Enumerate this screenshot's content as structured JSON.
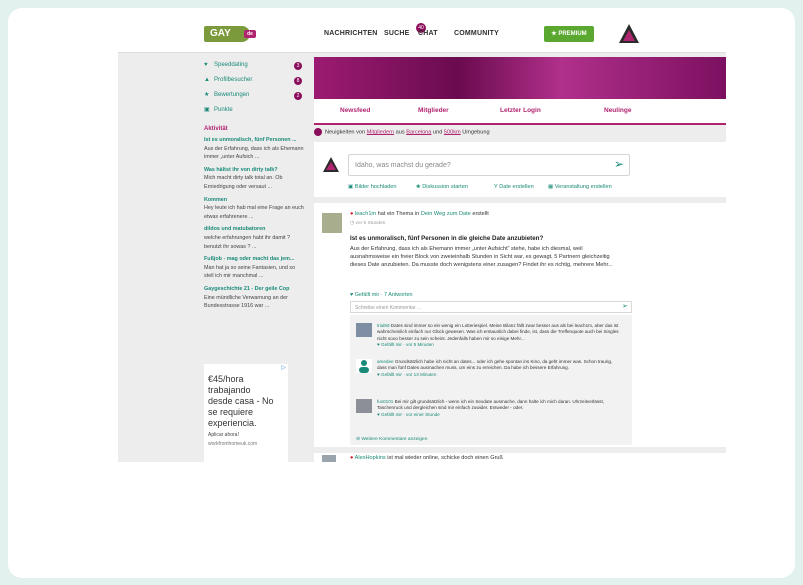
{
  "nav": {
    "logo": "GAY",
    "logo_tag": "de",
    "items": [
      "NACHRICHTEN",
      "SUCHE",
      "CHAT",
      "COMMUNITY"
    ],
    "chat_badge": "40",
    "premium": "PREMIUM"
  },
  "sidebar": {
    "items": [
      {
        "label": "Speeddating",
        "badge": "3"
      },
      {
        "label": "Profilbesucher",
        "badge": "8"
      },
      {
        "label": "Bewertungen",
        "badge": "2"
      },
      {
        "label": "Punkte",
        "badge": ""
      }
    ],
    "aktivitaet_title": "Aktivität",
    "aktivitaet": [
      {
        "title": "Ist es unmoralisch, fünf Personen ...",
        "desc": "Aus der Erfahrung, dass ich als Ehemann immer „unter Aufsich ..."
      },
      {
        "title": "Was hältst ihr von dirty talk?",
        "desc": "Mich macht dirty talk total an. Ob Erniedrigung oder versaut ..."
      },
      {
        "title": "Kommen",
        "desc": "Hey leute ich hab mal eine Frage an euch etwas erfahrenere ..."
      },
      {
        "title": "dildos und matubatoren",
        "desc": "welche erfahrungen habt ihr damit ? benutzt ihr sowas ? ..."
      },
      {
        "title": "Fußjob - mag oder macht das jem...",
        "desc": "Man hat ja so seine Fantasien, und so stell ich mir manchmal ..."
      },
      {
        "title": "Gaygeschichte 21 - Der geile Cop",
        "desc": "Eine mündliche Verwarnung an der Bundesstrasse 1916 war ..."
      }
    ]
  },
  "ad": {
    "line1": "€45/hora",
    "line2": "trabajando",
    "line3": "desde casa - No",
    "line4": "se requiere",
    "line5": "experiencia.",
    "cta": "Aplicar ahora!",
    "url": "workfromhomeuk.com"
  },
  "tabs": [
    "Newsfeed",
    "Mitglieder",
    "Letzter Login",
    "Neulinge"
  ],
  "info": {
    "pre": "Neuigkeiten von",
    "link1": "Mitgliedern",
    "mid": "aus",
    "link2": "Barcelona",
    "mid2": "und",
    "link3": "500km",
    "post": "Umgebung"
  },
  "composer": {
    "placeholder": "Idaho, was machst du gerade?",
    "actions": [
      "Bilder hochladen",
      "Diskussion starten",
      "Date erstellen",
      "Veranstaltung erstellen"
    ]
  },
  "post": {
    "user": "leach1m",
    "text": "hat ein Thema in",
    "topic": "Dein Weg zum Date",
    "suffix": "erstellt",
    "time": "vor 5 Stunden",
    "title": "Ist es unmoralisch, fünf Personen in die gleiche Date anzubieten?",
    "body": "Aus der Erfahrung, dass ich als Ehemann immer „unter Aufsicht“ stehe, habe ich diesmal, weil ausnahmsweise ein freier Block von zweieinhalb Stunden in Sicht war, es gewagt, 5 Partnern gleichzeitig dieses Date anzubieten. Da musste doch wenigstens einer zusagen? Findet ihr es richtig, mehrere Mehr...",
    "likes": "Gefällt mir · 7 Antworten",
    "comment_placeholder": "Schreibe einen Kommentar ..."
  },
  "comments": [
    {
      "user": "trial59",
      "text": "Dates sind immer so ein wenig ein Lotteriespiel. Meine Bilanz fällt zwar besser aus als bei leach1m, aber das ist wahrscheinlich einfach nur Glück gewesen. Was ich erstaunlich dabei finde, ist, dass die Treffenquote auch bei Singles nicht sooo besser zu sein scheint. Jedenfalls haben mir so einige Mehr...",
      "meta": "Gefällt mir · vor 5 Minuten"
    },
    {
      "user": "amedee",
      "text": "Grundsätzlich habe ich nicht an dates... oder ich gehe spontan ins Kino, da geht immer was. Schon traurig, dass man fünf Dates ausmachen muss, um eins zu erreichen. Da habe ich bessere Erfahrung.",
      "meta": "Gefällt mir · vor 13 Minuten"
    },
    {
      "user": "fux0101",
      "text": "Bei mir gilt grundsätzlich - wenn ich ein Sexdate ausmache, dann halte ich mich daran. Uhrzeitverlässt, Taschenruck und dergleichen sind mir einfach zuwider. Entweder - oder.",
      "meta": "Gefällt mir · vor einer Stunde"
    }
  ],
  "more_comments": "Weitere Kommentare anzeigen",
  "next_post": {
    "user": "AlexHopkins",
    "text": "ist mal wieder online, schicke doch einen Gruß"
  }
}
